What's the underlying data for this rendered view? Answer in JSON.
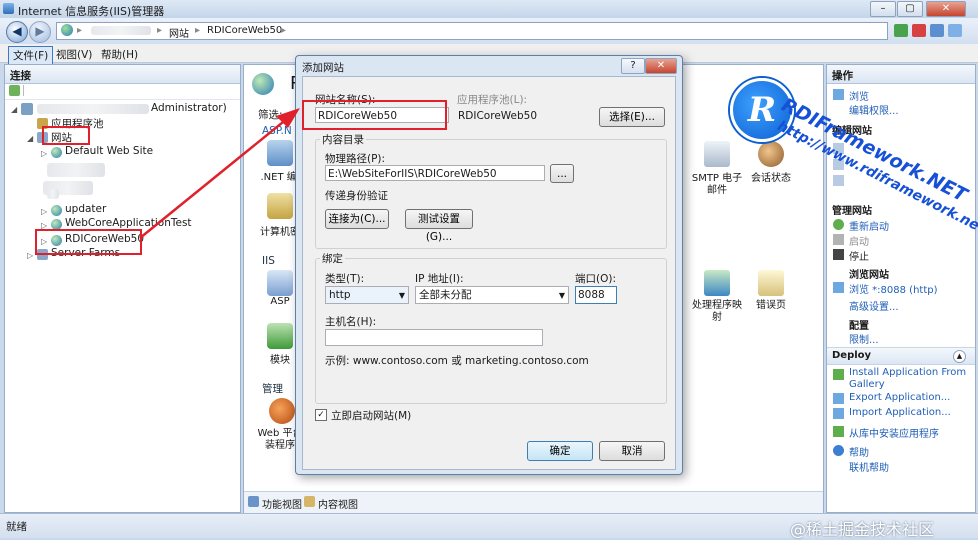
{
  "window": {
    "title": "Internet 信息服务(IIS)管理器",
    "minimize_glyph": "–",
    "maximize_glyph": "▢",
    "close_glyph": "✕"
  },
  "address": {
    "back_glyph": "◀",
    "forward_glyph": "▶",
    "crumbs": [
      "网站",
      "RDICoreWeb50"
    ],
    "separator": "▸"
  },
  "menu": {
    "file": "文件(F)",
    "view": "视图(V)",
    "help": "帮助(H)"
  },
  "left_panel": {
    "title": "连接",
    "server_suffix": "Administrator)",
    "tree": {
      "app_pools": "应用程序池",
      "sites": "网站",
      "default_site": "Default Web Site",
      "updater": "updater",
      "core_app_test": "WebCoreApplicationTest",
      "rdi_core": "RDICoreWeb50",
      "server_farms": "Server Farms"
    }
  },
  "center": {
    "title_char": "R",
    "filter_label": "筛选:",
    "sections": {
      "asp": "ASP.N",
      "iis": "IIS",
      "manage": "管理"
    },
    "icons": {
      "net_compile": ".NET 编i",
      "machine_key": "计算机密",
      "asp": "ASP",
      "modules": "模块",
      "web_platform_line1": "Web 平台",
      "web_platform_line2": "装程序",
      "smtp_line1": "SMTP 电子",
      "smtp_line2": "邮件",
      "session": "会话状态",
      "handler_line1": "处理程序映",
      "handler_line2": "射",
      "error_pages": "错误页"
    },
    "tabs": {
      "features": "功能视图",
      "content": "内容视图"
    }
  },
  "right_panel": {
    "title": "操作",
    "browse": "浏览",
    "edit_perms": "编辑权限...",
    "edit_site": "编辑网站",
    "manage_site": "管理网站",
    "restart": "重新启动",
    "start": "启动",
    "stop": "停止",
    "browse_site": "浏览网站",
    "browse_8088": "浏览 *:8088 (http)",
    "advanced": "高级设置...",
    "config": "配置",
    "limits": "限制...",
    "deploy": "Deploy",
    "install_from_gallery_1": "Install Application From",
    "install_from_gallery_2": "Gallery",
    "export_app": "Export Application...",
    "import_app": "Import Application...",
    "install_from_store": "从库中安装应用程序",
    "help": "帮助",
    "online_help": "联机帮助"
  },
  "dialog": {
    "title": "添加网站",
    "help_glyph": "?",
    "close_glyph": "✕",
    "site_name_label": "网站名称(S):",
    "site_name_value": "RDICoreWeb50",
    "app_pool_label": "应用程序池(L):",
    "app_pool_value": "RDICoreWeb50",
    "select_button": "选择(E)...",
    "content_dir_label": "内容目录",
    "physical_path_label": "物理路径(P):",
    "physical_path_value": "E:\\WebSiteForIIS\\RDICoreWeb50",
    "browse_button": "...",
    "pass_through_label": "传递身份验证",
    "connect_as_button": "连接为(C)...",
    "test_settings_button": "测试设置(G)...",
    "binding_label": "绑定",
    "type_label": "类型(T):",
    "type_value": "http",
    "ip_label": "IP 地址(I):",
    "ip_value": "全部未分配",
    "port_label": "端口(O):",
    "port_value": "8088",
    "host_label": "主机名(H):",
    "host_value": "",
    "example_text": "示例: www.contoso.com 或 marketing.contoso.com",
    "start_now_label": "立即启动网站(M)",
    "start_now_checked": true,
    "ok_button": "确定",
    "cancel_button": "取消"
  },
  "status": {
    "text": "就绪"
  },
  "watermark": {
    "logo_letter": "R",
    "text1": "RDIFramework.NET",
    "text2": "http://www.rdiframework.net",
    "footer": "@稀土掘金技术社区"
  },
  "colors": {
    "annotation_red": "#e0212b",
    "link_blue": "#1f5fb6",
    "watermark_blue": "#1550d6"
  }
}
